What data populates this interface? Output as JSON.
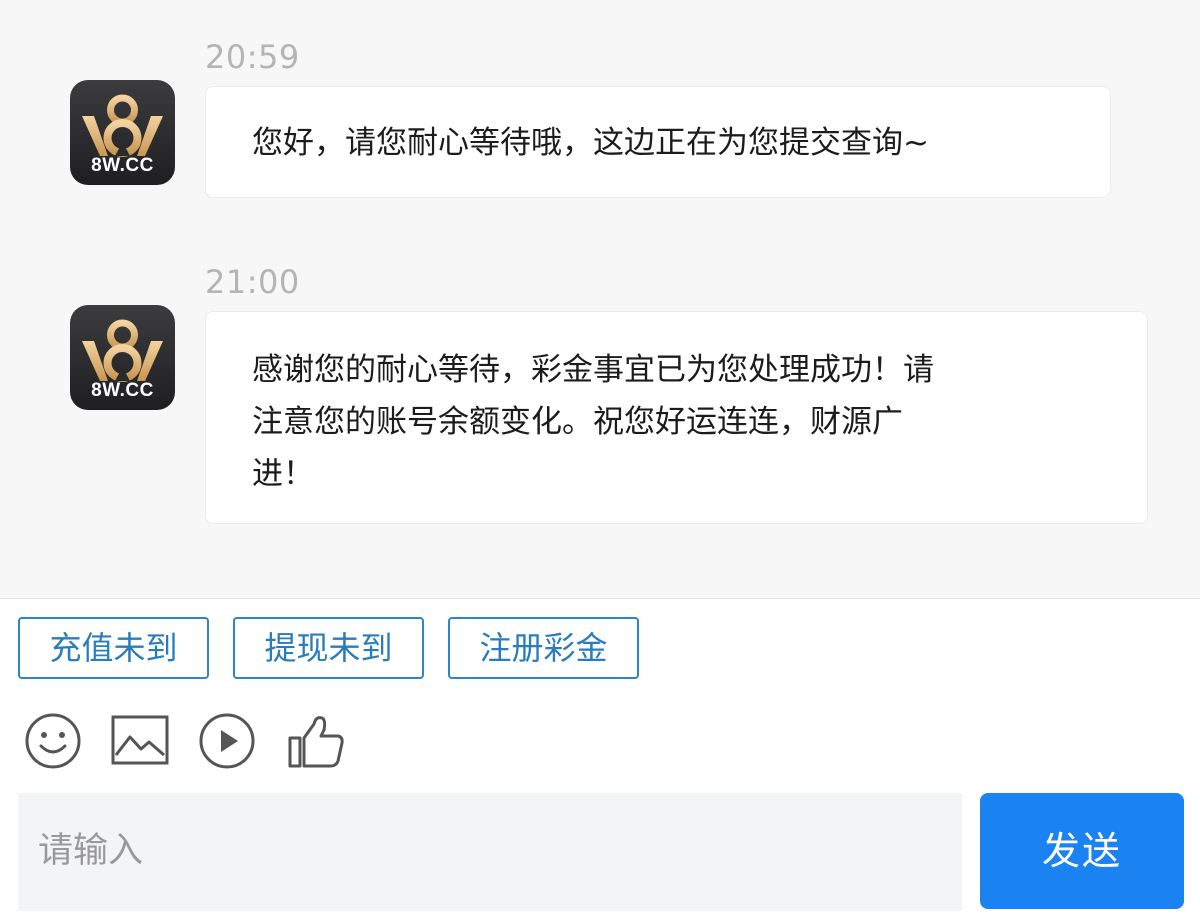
{
  "messages": [
    {
      "time": "20:59",
      "avatar_label": "8W.CC",
      "lines": [
        "您好，请您耐心等待哦，这边正在为您提交查询~"
      ]
    },
    {
      "time": "21:00",
      "avatar_label": "8W.CC",
      "lines": [
        "感谢您的耐心等待，彩金事宜已为您处理成功！请",
        "注意您的账号余额变化。祝您好运连连，财源广",
        "进！"
      ]
    }
  ],
  "quick_replies": [
    "充值未到",
    "提现未到",
    "注册彩金"
  ],
  "toolbar": {
    "icons": [
      "emoji-icon",
      "image-icon",
      "video-icon",
      "thumbs-up-icon"
    ]
  },
  "composer": {
    "placeholder": "请输入",
    "send_label": "发送"
  },
  "colors": {
    "accent": "#1b83f1",
    "quick_reply_border": "#2f86c4",
    "chat_background": "#f7f7f8"
  }
}
